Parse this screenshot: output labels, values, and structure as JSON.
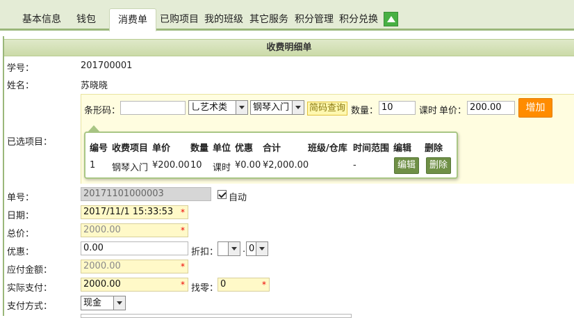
{
  "tabs": [
    {
      "label": "基本信息"
    },
    {
      "label": "钱包"
    },
    {
      "label": "消费单"
    },
    {
      "label": "已购项目"
    },
    {
      "label": "我的班级"
    },
    {
      "label": "其它服务"
    },
    {
      "label": "积分管理"
    },
    {
      "label": "积分兑换"
    }
  ],
  "active_tab": "消费单",
  "colors": {
    "accent_green": "#9ab77a",
    "add_button": "#ff8c00",
    "required_star": "#e00000"
  },
  "title": "收费明细单",
  "student": {
    "id_label": "学号：",
    "id_value": "201700001",
    "name_label": "姓名：",
    "name_value": "苏晓晓"
  },
  "selected_projects": {
    "label": "已选项目：",
    "barcode_label": "条形码：",
    "barcode_value": "",
    "category_select": "乚艺术类",
    "item_select": "钢琴入门",
    "code_search_button": "简码查询",
    "quantity_label": "数量：",
    "quantity_value": "10",
    "unit_text": "课时",
    "unit_price_label": "单价：",
    "unit_price_value": "200.00",
    "add_button": "增加",
    "table": {
      "headers": [
        "编号",
        "收费项目",
        "单价",
        "数量",
        "单位",
        "优惠",
        "合计",
        "班级/仓库",
        "时间范围",
        "编辑",
        "删除"
      ],
      "rows": [
        {
          "no": "1",
          "item": "钢琴入门",
          "price": "¥200.00",
          "qty": "10",
          "unit": "课时",
          "discount": "¥0.00",
          "total": "¥2,000.00",
          "class": "",
          "range": "-",
          "edit": "编辑",
          "delete": "删除"
        }
      ]
    }
  },
  "order": {
    "number_label": "单号：",
    "number_value": "20171101000003",
    "auto_label": "自动",
    "auto_checked": true,
    "date_label": "日期：",
    "date_value": "2017/11/1 15:33:53",
    "total_label": "总价：",
    "total_value": "2000.00",
    "discount_label": "优惠：",
    "discount_value": "0.00",
    "rebate_label": "折扣：",
    "rebate_int": "",
    "rebate_dot": ".",
    "rebate_dec": "0",
    "payable_label": "应付金额：",
    "payable_value": "2000.00",
    "paid_label": "实际支付：",
    "paid_value": "2000.00",
    "change_label": "找零：",
    "change_value": "0",
    "pay_method_label": "支付方式：",
    "pay_method_value": "现金",
    "required_mark": "*"
  }
}
